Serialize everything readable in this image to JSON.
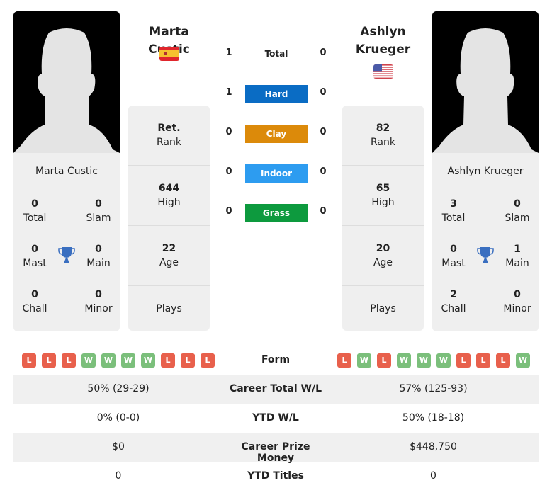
{
  "player1": {
    "name": "Marta Custic",
    "country": "Spain",
    "flag_icon": "spain-flag-icon",
    "titles": {
      "total": "0",
      "slam": "0",
      "mast": "0",
      "main": "0",
      "chall": "0",
      "minor": "0"
    },
    "rank": "Ret.",
    "high": "644",
    "age": "22",
    "plays": "",
    "form": [
      "L",
      "L",
      "L",
      "W",
      "W",
      "W",
      "W",
      "L",
      "L",
      "L"
    ],
    "career_wl": "50% (29-29)",
    "ytd_wl": "0% (0-0)",
    "prize_money": "$0",
    "ytd_titles": "0"
  },
  "player2": {
    "name": "Ashlyn Krueger",
    "name_line1": "Ashlyn",
    "name_line2": "Krueger",
    "country": "USA",
    "flag_icon": "usa-flag-icon",
    "titles": {
      "total": "3",
      "slam": "0",
      "mast": "0",
      "main": "1",
      "chall": "2",
      "minor": "0"
    },
    "rank": "82",
    "high": "65",
    "age": "20",
    "plays": "",
    "form": [
      "L",
      "W",
      "L",
      "W",
      "W",
      "W",
      "L",
      "L",
      "L",
      "W"
    ],
    "career_wl": "57% (125-93)",
    "ytd_wl": "50% (18-18)",
    "prize_money": "$448,750",
    "ytd_titles": "0"
  },
  "labels": {
    "total": "Total",
    "slam": "Slam",
    "mast": "Mast",
    "main": "Main",
    "chall": "Chall",
    "minor": "Minor",
    "rank": "Rank",
    "high": "High",
    "age": "Age",
    "plays": "Plays",
    "form": "Form",
    "career_wl": "Career Total W/L",
    "ytd_wl": "YTD W/L",
    "prize_money": "Career Prize Money",
    "ytd_titles": "YTD Titles"
  },
  "h2h": {
    "total": {
      "label": "Total",
      "p1": "1",
      "p2": "0"
    },
    "surfaces": [
      {
        "label": "Hard",
        "p1": "1",
        "p2": "0",
        "color": "#0a6cc4"
      },
      {
        "label": "Clay",
        "p1": "0",
        "p2": "0",
        "color": "#dc8a0a"
      },
      {
        "label": "Indoor",
        "p1": "0",
        "p2": "0",
        "color": "#2d9cf0"
      },
      {
        "label": "Grass",
        "p1": "0",
        "p2": "0",
        "color": "#0d9a3e"
      }
    ]
  }
}
